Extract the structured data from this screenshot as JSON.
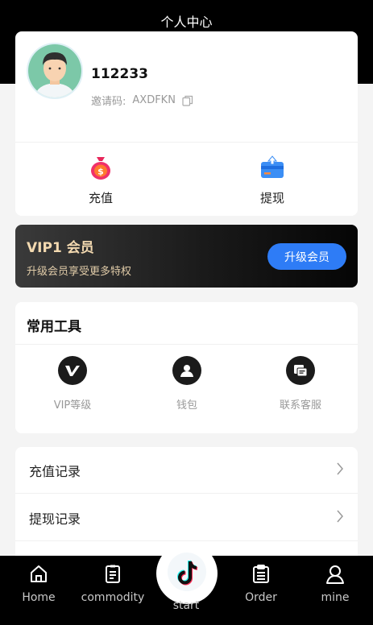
{
  "header": {
    "title": "个人中心"
  },
  "profile": {
    "username": "112233",
    "invite_label": "邀请码:",
    "invite_code": "AXDFKN"
  },
  "actions": {
    "recharge": "充值",
    "withdraw": "提现"
  },
  "vip": {
    "title": "VIP1 会员",
    "subtitle": "升级会员享受更多特权",
    "button": "升级会员",
    "button_color": "#2e7cf6"
  },
  "tools": {
    "title": "常用工具",
    "items": [
      {
        "label": "VIP等级",
        "icon": "vip-icon"
      },
      {
        "label": "钱包",
        "icon": "wallet-icon"
      },
      {
        "label": "联系客服",
        "icon": "customer-service-icon"
      }
    ]
  },
  "records": [
    {
      "label": "充值记录"
    },
    {
      "label": "提现记录"
    }
  ],
  "tabbar": {
    "items": [
      {
        "label": "Home",
        "icon": "home-icon"
      },
      {
        "label": "commodity",
        "icon": "commodity-icon"
      },
      {
        "label": "start",
        "icon": "tiktok-icon"
      },
      {
        "label": "Order",
        "icon": "order-icon"
      },
      {
        "label": "mine",
        "icon": "mine-icon"
      }
    ]
  }
}
